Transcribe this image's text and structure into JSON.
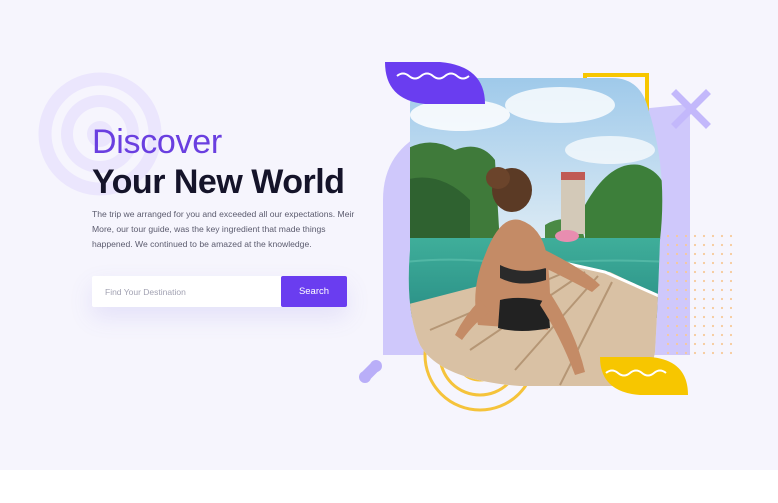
{
  "hero": {
    "title_line1": "Discover",
    "title_line2": "Your New World",
    "description": "The trip we arranged for you and exceeded all our expectations. Meir More, our tour guide, was the key ingredient that made things happened. We continued to be amazed at the knowledge."
  },
  "search": {
    "placeholder": "Find Your Destination",
    "value": "",
    "button_label": "Search"
  },
  "colors": {
    "accent_purple": "#6a3df0",
    "accent_yellow": "#f7c600",
    "light_purple": "#cfc8fb",
    "background": "#f6f5fd"
  },
  "icons": [
    "spiral-icon",
    "close-x-icon",
    "wave-icon",
    "dot-grid",
    "concentric-circles-icon",
    "link-dots-icon"
  ],
  "photo": {
    "subject": "woman sitting on the bow of a longtail boat near limestone cliffs"
  }
}
